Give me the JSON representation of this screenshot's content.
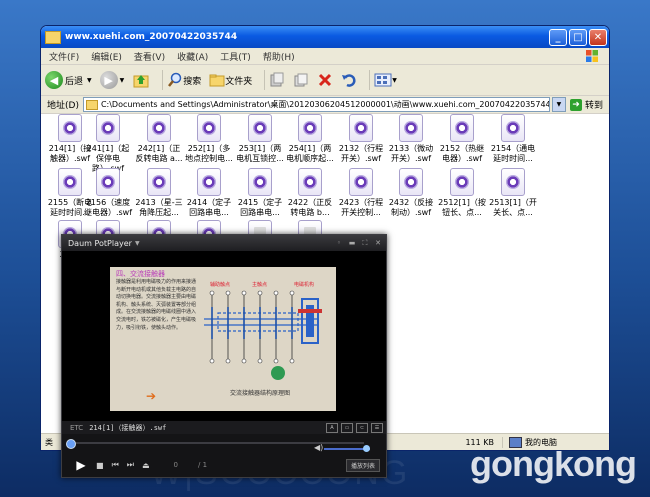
{
  "explorer": {
    "title": "www.xuehi.com_20070422035744",
    "menu": [
      "文件(F)",
      "编辑(E)",
      "查看(V)",
      "收藏(A)",
      "工具(T)",
      "帮助(H)"
    ],
    "toolbar": {
      "back": "后退",
      "search": "搜索",
      "folders": "文件夹"
    },
    "address_label": "地址(D)",
    "address_value": "C:\\Documents and Settings\\Administrator\\桌面\\20120306204512000001\\动画\\www.xuehi.com_20070422035744",
    "go_label": "转到",
    "files": [
      {
        "name": "214[1]（接触器）.swf"
      },
      {
        "name": "241[1]（起保停电路）.swf"
      },
      {
        "name": "242[1]（正反转电路 a..."
      },
      {
        "name": "252[1]（多地点控制电..."
      },
      {
        "name": "253[1]（两电机互锁控..."
      },
      {
        "name": "254[1]（两电机顺序起..."
      },
      {
        "name": "2132（行程开关）.swf"
      },
      {
        "name": "2133（微动开关）.swf"
      },
      {
        "name": "2152（热继电器）.swf"
      },
      {
        "name": "2154（通电延时时间..."
      },
      {
        "name": "2155（断电延时时间..."
      },
      {
        "name": "2156（速度继电器）.swf"
      },
      {
        "name": "2413（星-三角降压起..."
      },
      {
        "name": "2414（定子回路串电..."
      },
      {
        "name": "2415（定子回路串电..."
      },
      {
        "name": "2422（正反转电路 b..."
      },
      {
        "name": "2423（行程开关控制..."
      },
      {
        "name": "2432（反接制动）.swf"
      },
      {
        "name": "2512[1]（按钮长、点..."
      },
      {
        "name": "2513[1]（开关长、点..."
      },
      {
        "name": "25 控"
      },
      {
        "name": ""
      },
      {
        "name": ""
      },
      {
        "name": ""
      },
      {
        "name": ""
      },
      {
        "name": ""
      }
    ],
    "status": {
      "left": "类",
      "size": "111 KB",
      "location": "我的电脑"
    }
  },
  "player": {
    "brand": "Daum PotPlayer",
    "etc": "ETC",
    "file": "214[1]（接触器）.swf",
    "time_current": "0",
    "time_total": "/ 1",
    "progress": 0.0,
    "volume": 0.92,
    "playlist_label": "播放列表",
    "slide": {
      "title": "四、交流接触器",
      "body": "接触器是利用电磁吸力的作用来接通与断开电动机或其他负载主电路的自动切换电器。交流接触器主要由电磁机构、触头系统、灭弧装置等部分组成。在交流接触器的电磁线圈中通入交流电时，铁芯被磁化，产生电磁吸力，吸引衔铁，使触头动作。",
      "label_main": "辅助触点",
      "label_top": "主触点",
      "label_right": "电磁机构",
      "caption": "交流接触器结构原理图"
    }
  },
  "watermark": "gongkong"
}
